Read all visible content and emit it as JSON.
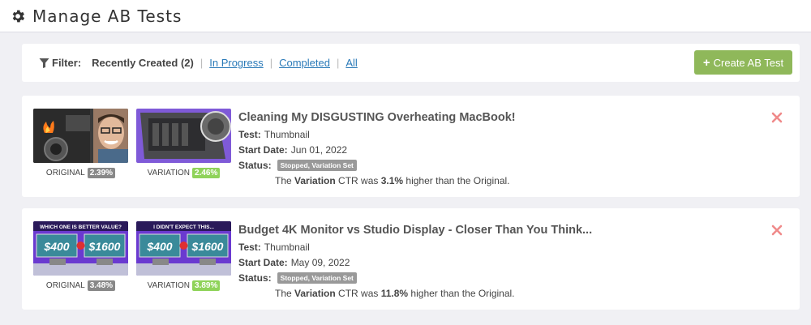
{
  "header": {
    "title": "Manage AB Tests",
    "icon": "gear-icon"
  },
  "filter": {
    "label": "Filter:",
    "current": "Recently Created (2)",
    "links": [
      "In Progress",
      "Completed",
      "All"
    ],
    "separator": "|",
    "create_button": "Create AB Test"
  },
  "tests": [
    {
      "title": "Cleaning My DISGUSTING Overheating MacBook!",
      "test_label": "Test:",
      "test_value": "Thumbnail",
      "start_label": "Start Date:",
      "start_value": "Jun 01, 2022",
      "status_label": "Status:",
      "status_value": "Stopped, Variation Set",
      "original_label": "ORIGINAL",
      "original_pct": "2.39%",
      "variation_label": "VARIATION",
      "variation_pct": "2.46%",
      "result_pre": "The ",
      "result_var": "Variation",
      "result_mid": " CTR was ",
      "result_pct": "3.1%",
      "result_post": " higher than the Original."
    },
    {
      "title": "Budget 4K Monitor vs Studio Display - Closer Than You Think...",
      "test_label": "Test:",
      "test_value": "Thumbnail",
      "start_label": "Start Date:",
      "start_value": "May 09, 2022",
      "status_label": "Status:",
      "status_value": "Stopped, Variation Set",
      "original_label": "ORIGINAL",
      "original_pct": "3.48%",
      "variation_label": "VARIATION",
      "variation_pct": "3.89%",
      "result_pre": "The ",
      "result_var": "Variation",
      "result_mid": " CTR was ",
      "result_pct": "11.8%",
      "result_post": " higher than the Original.",
      "thumb_text_original": "WHICH ONE IS BETTER VALUE?",
      "thumb_text_variation": "I DIDN'T EXPECT THIS...",
      "thumb_price_left": "$400",
      "thumb_price_right": "$1600"
    }
  ],
  "colors": {
    "accent_green": "#8fb85a",
    "link": "#2a7ab8",
    "delete": "#f08a8a",
    "pct_green": "#8fd35a"
  }
}
